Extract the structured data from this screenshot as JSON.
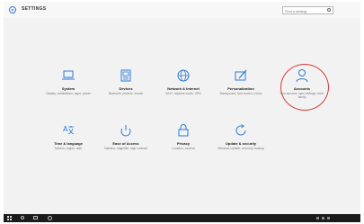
{
  "app": {
    "title": "SETTINGS",
    "icon": "gear-icon"
  },
  "search": {
    "placeholder": "Find a setting",
    "icon": "search-icon"
  },
  "colors": {
    "accent": "#2a7ad5",
    "highlight": "#d43a3a",
    "taskbar": "#1b1b1b",
    "background": "#f2f2f2"
  },
  "tiles": [
    {
      "label": "System",
      "desc": "Display, notifications, apps, power",
      "icon": "laptop-icon"
    },
    {
      "label": "Devices",
      "desc": "Bluetooth, printers, mouse",
      "icon": "devices-icon"
    },
    {
      "label": "Network & Internet",
      "desc": "Wi-Fi, airplane mode, VPN",
      "icon": "globe-icon"
    },
    {
      "label": "Personalization",
      "desc": "Background, lock screen, colors",
      "icon": "personalization-icon"
    },
    {
      "label": "Accounts",
      "desc": "Your account, sync settings, work, family",
      "icon": "person-icon"
    },
    {
      "label": "Time & language",
      "desc": "Speech, region, date",
      "icon": "time-language-icon"
    },
    {
      "label": "Ease of Access",
      "desc": "Narrator, magnifier, high contrast",
      "icon": "ease-of-access-icon"
    },
    {
      "label": "Privacy",
      "desc": "Location, camera",
      "icon": "lock-icon"
    },
    {
      "label": "Update & security",
      "desc": "Windows Update, recovery, backup",
      "icon": "update-icon"
    }
  ],
  "taskbar": {
    "start_icon": "windows-start-icon",
    "clock_time": "",
    "clock_date": ""
  }
}
